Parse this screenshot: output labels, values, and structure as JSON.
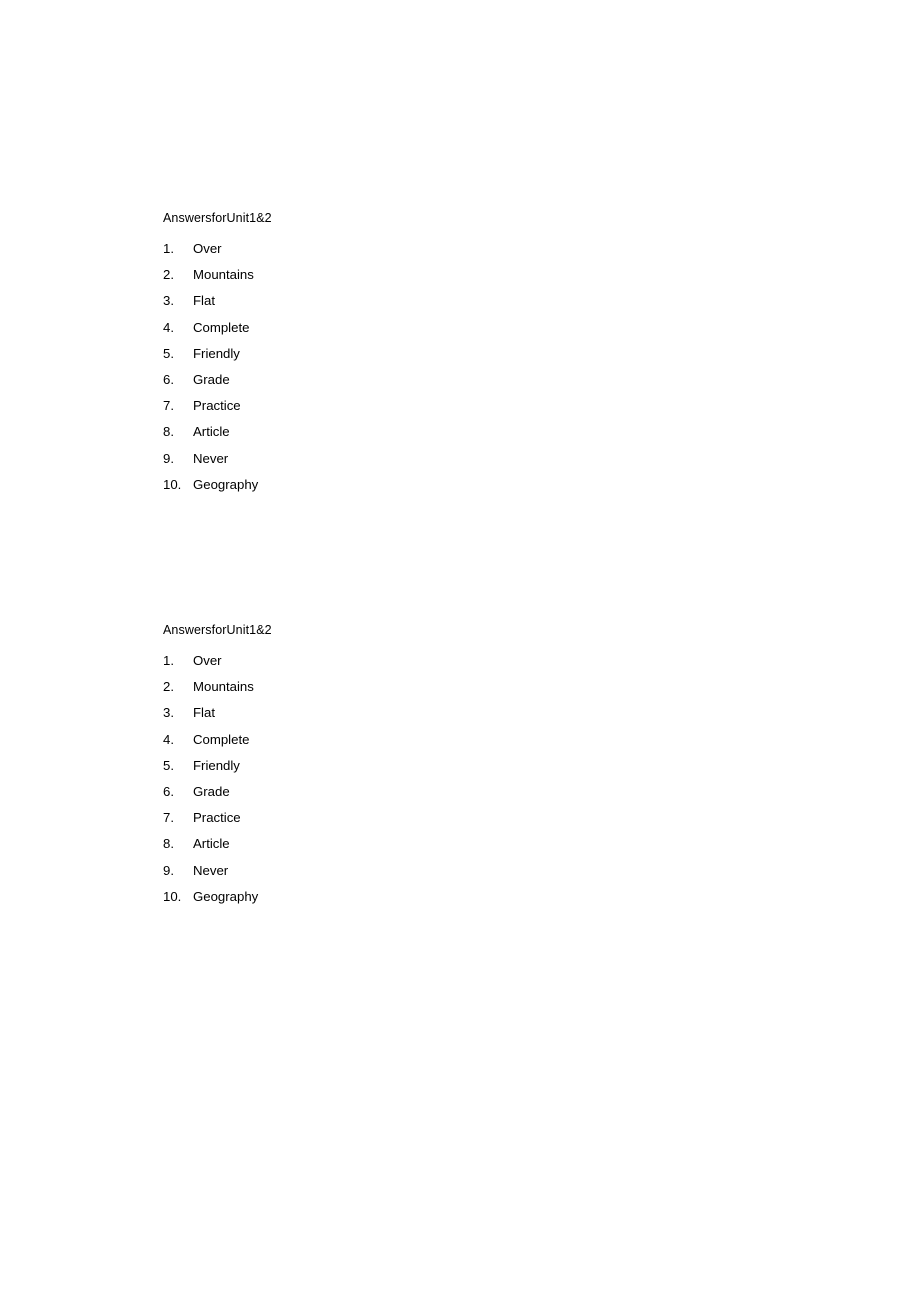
{
  "document": {
    "background_color": "#ffffff",
    "text_color": "#000000",
    "blocks": [
      {
        "title": "AnswersforUnit1&2",
        "items": [
          {
            "number": "1.",
            "label": "Over"
          },
          {
            "number": "2.",
            "label": "Mountains"
          },
          {
            "number": "3.",
            "label": "Flat"
          },
          {
            "number": "4.",
            "label": "Complete"
          },
          {
            "number": "5.",
            "label": "Friendly"
          },
          {
            "number": "6.",
            "label": "Grade"
          },
          {
            "number": "7.",
            "label": "Practice"
          },
          {
            "number": "8.",
            "label": "Article"
          },
          {
            "number": "9.",
            "label": "Never"
          },
          {
            "number": "10.",
            "label": "Geography"
          }
        ]
      },
      {
        "title": "AnswersforUnit1&2",
        "items": [
          {
            "number": "1.",
            "label": "Over"
          },
          {
            "number": "2.",
            "label": "Mountains"
          },
          {
            "number": "3.",
            "label": "Flat"
          },
          {
            "number": "4.",
            "label": "Complete"
          },
          {
            "number": "5.",
            "label": "Friendly"
          },
          {
            "number": "6.",
            "label": "Grade"
          },
          {
            "number": "7.",
            "label": "Practice"
          },
          {
            "number": "8.",
            "label": "Article"
          },
          {
            "number": "9.",
            "label": "Never"
          },
          {
            "number": "10.",
            "label": "Geography"
          }
        ]
      }
    ]
  }
}
